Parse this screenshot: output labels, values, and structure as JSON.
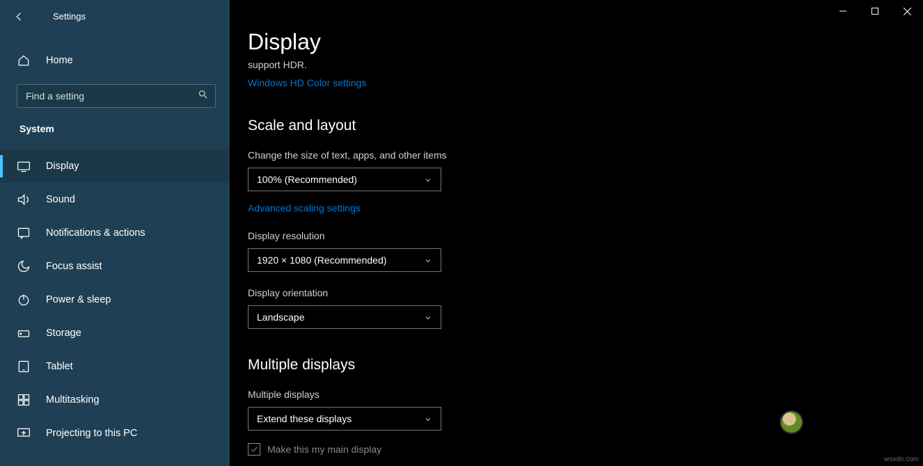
{
  "window": {
    "app_title": "Settings"
  },
  "sidebar": {
    "home_label": "Home",
    "search_placeholder": "Find a setting",
    "category_label": "System",
    "items": [
      {
        "label": "Display",
        "icon": "display-icon",
        "active": true
      },
      {
        "label": "Sound",
        "icon": "sound-icon"
      },
      {
        "label": "Notifications & actions",
        "icon": "notifications-icon"
      },
      {
        "label": "Focus assist",
        "icon": "focus-icon"
      },
      {
        "label": "Power & sleep",
        "icon": "power-icon"
      },
      {
        "label": "Storage",
        "icon": "storage-icon"
      },
      {
        "label": "Tablet",
        "icon": "tablet-icon"
      },
      {
        "label": "Multitasking",
        "icon": "multitasking-icon"
      },
      {
        "label": "Projecting to this PC",
        "icon": "projecting-icon"
      }
    ]
  },
  "main": {
    "title": "Display",
    "hdr_desc": "support HDR.",
    "hdr_link": "Windows HD Color settings",
    "section_scale_title": "Scale and layout",
    "scale_label": "Change the size of text, apps, and other items",
    "scale_value": "100% (Recommended)",
    "advanced_scaling_link": "Advanced scaling settings",
    "resolution_label": "Display resolution",
    "resolution_value": "1920 × 1080 (Recommended)",
    "orientation_label": "Display orientation",
    "orientation_value": "Landscape",
    "section_multiple_title": "Multiple displays",
    "multiple_label": "Multiple displays",
    "multiple_value": "Extend these displays",
    "main_display_checkbox": "Make this my main display"
  },
  "watermark": "wsxdn.com"
}
